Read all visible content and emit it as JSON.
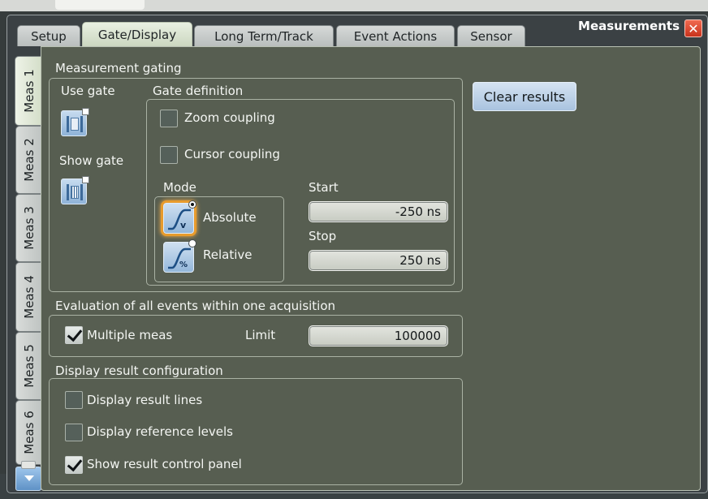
{
  "dialog": {
    "title": "Measurements",
    "close_glyph": "✕"
  },
  "tabs": [
    {
      "label": "Setup",
      "active": false
    },
    {
      "label": "Gate/Display",
      "active": true
    },
    {
      "label": "Long Term/Track",
      "active": false
    },
    {
      "label": "Event Actions",
      "active": false
    },
    {
      "label": "Sensor",
      "active": false
    }
  ],
  "side_tabs": [
    {
      "label": "Meas 1",
      "active": true
    },
    {
      "label": "Meas 2",
      "active": false
    },
    {
      "label": "Meas 3",
      "active": false
    },
    {
      "label": "Meas 4",
      "active": false
    },
    {
      "label": "Meas 5",
      "active": false
    },
    {
      "label": "Meas 6",
      "active": false
    }
  ],
  "gating": {
    "section_title": "Measurement gating",
    "use_gate_label": "Use gate",
    "show_gate_label": "Show gate",
    "gate_definition_label": "Gate definition",
    "zoom_coupling_label": "Zoom coupling",
    "zoom_coupling_checked": false,
    "cursor_coupling_label": "Cursor coupling",
    "cursor_coupling_checked": false,
    "mode_label": "Mode",
    "absolute_label": "Absolute",
    "relative_label": "Relative",
    "mode_selected": "Absolute",
    "start_label": "Start",
    "start_value": "-250 ns",
    "stop_label": "Stop",
    "stop_value": "250 ns",
    "clear_results_label": "Clear results"
  },
  "evaluation": {
    "section_title": "Evaluation of all events within one acquisition",
    "multiple_meas_label": "Multiple meas",
    "multiple_meas_checked": true,
    "limit_label": "Limit",
    "limit_value": "100000"
  },
  "display_config": {
    "section_title": "Display result configuration",
    "result_lines_label": "Display result lines",
    "result_lines_checked": false,
    "reference_levels_label": "Display reference levels",
    "reference_levels_checked": false,
    "result_panel_label": "Show result control panel",
    "result_panel_checked": true
  },
  "icons": {
    "use_gate": "gate-toggle-icon",
    "show_gate": "show-gate-icon",
    "absolute": "absolute-mode-icon",
    "relative": "relative-mode-icon"
  },
  "colors": {
    "panel": "#586052",
    "selection_glow": "#e89b2c",
    "close": "#d8402a",
    "button_blue": "#a9c3df"
  }
}
